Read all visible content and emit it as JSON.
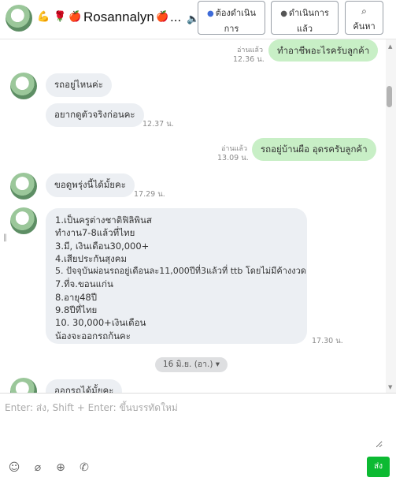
{
  "header": {
    "contact_name": "Rosannalyn",
    "emojis": [
      "💪",
      "🌹",
      "🍎",
      "🍎"
    ],
    "ellipsis": "...",
    "speaker_icon": "speaker-icon",
    "buttons": [
      {
        "icon": "chat-bubble-icon",
        "line1": "ต้องดำเนิน",
        "line2": "การ"
      },
      {
        "icon": "chat-done-icon",
        "line1": "ดำเนินการ",
        "line2": "แล้ว"
      },
      {
        "icon": "search-icon",
        "line1": "Q",
        "line2": "ค้นหา"
      }
    ]
  },
  "messages": [
    {
      "side": "out",
      "text": "ทำอาชีพอะไรครับลูกค้า",
      "read": "อ่านแล้ว",
      "time": "12.36 น."
    },
    {
      "side": "in",
      "text": "รถอยู่ไหนค่ะ"
    },
    {
      "side": "in",
      "text": "อยากดูตัวจริงก่อนคะ",
      "time": "12.37 น."
    },
    {
      "side": "out",
      "text": "รถอยู่บ้านผือ อุดรครับลูกค้า",
      "read": "อ่านแล้ว",
      "time": "13.09 น."
    },
    {
      "side": "in",
      "text": "ขอดูพรุ่งนี้ได้มั้ยคะ",
      "time": "17.29 น."
    },
    {
      "side": "in",
      "lines": [
        "1.เป็นครูต่างชาติฟิลิพินส",
        "ทำงาน7-8แล้วที่ไทย",
        "3.มี, เงินเดือน30,000+",
        "4.เสียประกันสุงคม",
        "5. ปัจจุบันผ่อนรถอยู่เดือนละ11,000ปีที่3แล้วที่ ttb โดยไม่มีค้างงวด",
        "7.ที่จ.ขอนแก่น",
        "8.อายุ48ปี",
        "9.8ปีที่ไทย",
        "10. 30,000+เงินเดือน",
        "น้องจะออกรถก้นคะ"
      ],
      "time": "17.30 น."
    },
    {
      "side": "in",
      "text": "ออกรถได้มั้ยคะ"
    }
  ],
  "date_divider": "16 มิ.ย. (อา.) ▾",
  "composer": {
    "placeholder": "Enter: ส่ง, Shift + Enter: ขึ้นบรรทัดใหม่",
    "tools": [
      "emoji-icon",
      "attachment-icon",
      "add-icon",
      "line-call-icon"
    ],
    "send_label": "ส่ง"
  },
  "colors": {
    "outgoing_bubble": "#c8efc6",
    "incoming_bubble": "#eceff3",
    "send_button": "#0cba32",
    "accent": "#3e6bd8"
  }
}
